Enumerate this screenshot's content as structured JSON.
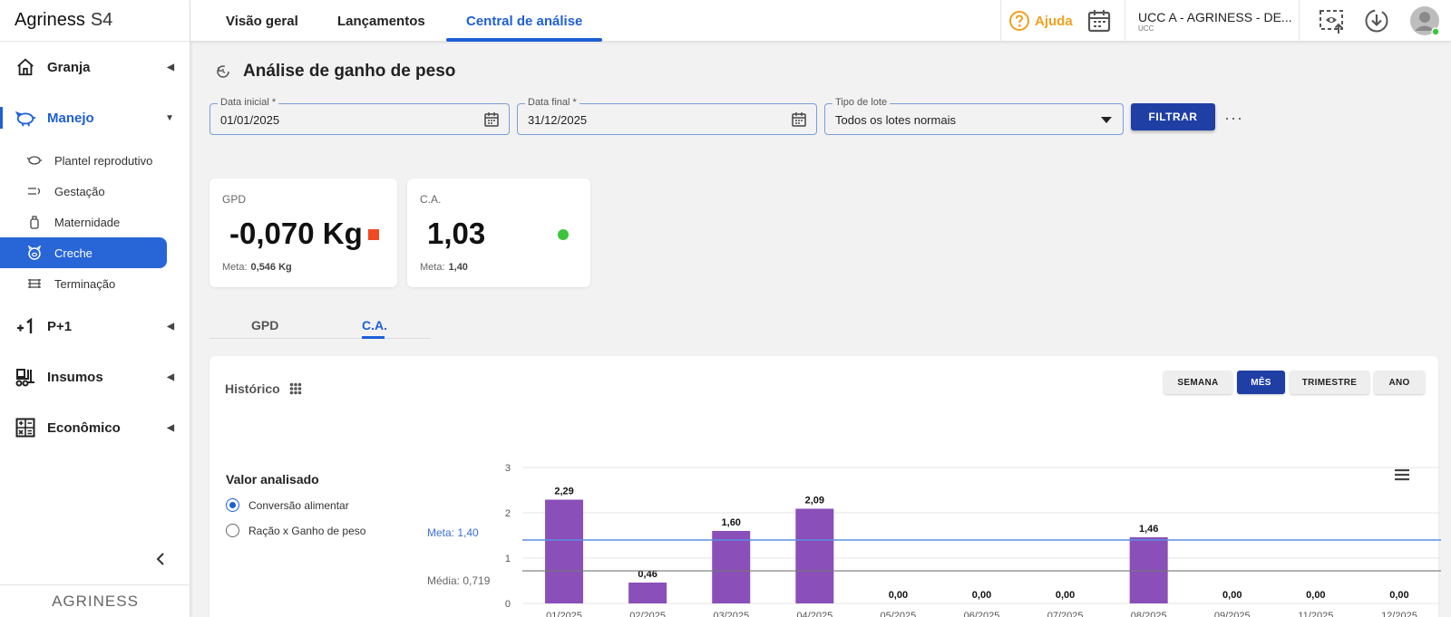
{
  "app": {
    "brand": "Agriness",
    "brand_suffix": "S4",
    "footer_logo": "AGRINESS"
  },
  "sidebar": {
    "items": [
      {
        "label": "Granja",
        "icon": "home-icon"
      },
      {
        "label": "Manejo",
        "icon": "pig-icon"
      },
      {
        "label": "P+1",
        "icon": "plus-one-icon"
      },
      {
        "label": "Insumos",
        "icon": "forklift-icon"
      },
      {
        "label": "Econômico",
        "icon": "calculator-icon"
      }
    ],
    "subitems": [
      {
        "label": "Plantel reprodutivo"
      },
      {
        "label": "Gestação"
      },
      {
        "label": "Maternidade"
      },
      {
        "label": "Creche"
      },
      {
        "label": "Terminação"
      }
    ]
  },
  "header": {
    "tabs": [
      "Visão geral",
      "Lançamentos",
      "Central de análise"
    ],
    "help": "Ajuda",
    "unit_name": "UCC A - AGRINESS - DE...",
    "unit_sub": "UCC"
  },
  "page": {
    "title": "Análise de ganho de peso",
    "filters": {
      "start_label": "Data inicial *",
      "start_value": "01/01/2025",
      "end_label": "Data final *",
      "end_value": "31/12/2025",
      "type_label": "Tipo de lote",
      "type_value": "Todos os lotes normais",
      "filter_button": "FILTRAR",
      "more": "···"
    },
    "cards": [
      {
        "title": "GPD",
        "value": "-0,070 Kg",
        "meta_label": "Meta:",
        "meta_value": "0,546 Kg",
        "status_color": "#f04a24"
      },
      {
        "title": "C.A.",
        "value": "1,03",
        "meta_label": "Meta:",
        "meta_value": "1,40",
        "status_color": "#3cc43c"
      }
    ],
    "subtabs": [
      "GPD",
      "C.A."
    ],
    "historico": {
      "title": "Histórico",
      "periods": [
        "SEMANA",
        "MÊS",
        "TRIMESTRE",
        "ANO"
      ],
      "active_period": "MÊS",
      "valor_analisado_title": "Valor analisado",
      "options": [
        "Conversão alimentar",
        "Ração x Ganho de peso"
      ],
      "meta_label": "Meta: 1,40",
      "media_label": "Média: 0,719"
    }
  },
  "chart_data": {
    "type": "bar",
    "categories": [
      "01/2025",
      "02/2025",
      "03/2025",
      "04/2025",
      "05/2025",
      "06/2025",
      "07/2025",
      "08/2025",
      "09/2025",
      "11/2025",
      "12/2025"
    ],
    "values": [
      2.29,
      0.46,
      1.6,
      2.09,
      0.0,
      0.0,
      0.0,
      1.46,
      0.0,
      0.0,
      0.0
    ],
    "data_labels": [
      "2,29",
      "0,46",
      "1,60",
      "2,09",
      "0,00",
      "0,00",
      "0,00",
      "1,46",
      "0,00",
      "0,00",
      "0,00"
    ],
    "ylim": [
      0,
      3
    ],
    "yticks": [
      "0",
      "1",
      "2",
      "3"
    ],
    "meta_line": 1.4,
    "media_line": 0.719,
    "bar_color": "#8a4fb8",
    "meta_color": "#5b8fe0",
    "media_color": "#777777",
    "grid": true
  }
}
